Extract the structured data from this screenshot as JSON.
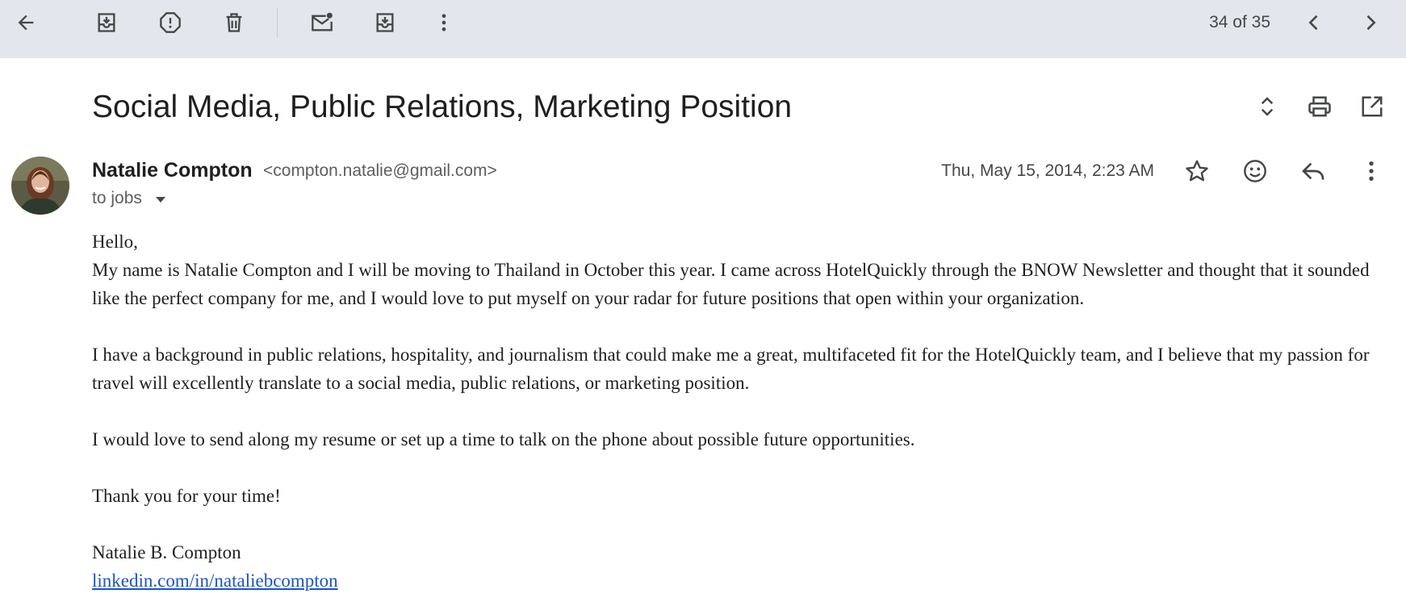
{
  "toolbar": {
    "back_icon": "arrow-left-icon",
    "archive_icon": "archive-icon",
    "spam_icon": "report-spam-icon",
    "delete_icon": "trash-icon",
    "mark_unread_icon": "mark-unread-icon",
    "move_icon": "move-to-inbox-icon",
    "more_icon": "more-vertical-icon",
    "count": "34 of 35",
    "prev_icon": "chevron-left-icon",
    "next_icon": "chevron-right-icon"
  },
  "email": {
    "subject": "Social Media, Public Relations, Marketing Position",
    "sender_name": "Natalie Compton",
    "sender_email": "<compton.natalie@gmail.com>",
    "to": "to jobs",
    "date": "Thu, May 15, 2014, 2:23 AM",
    "body": {
      "greeting": "Hello,",
      "p1": "My name is Natalie Compton and I will be moving to Thailand in October this year. I came across HotelQuickly through the BNOW Newsletter and thought that it sounded like the perfect company for me, and I would love to put myself on your radar for future positions that open within your organization.",
      "p2": "I have a background in public relations, hospitality, and journalism that could make me a great, multifaceted fit for the HotelQuickly team, and I believe that my passion for travel will excellently translate to a social media, public relations, or marketing position.",
      "p3": "I would love to send along my resume or set up a time to talk on the phone about possible future opportunities.",
      "p4": "Thank you for your time!",
      "signature_name": "Natalie B. Compton",
      "signature_link": "linkedin.com/in/nataliebcompton"
    }
  },
  "colors": {
    "toolbar_bg": "#e3e6ec",
    "link": "#1a55c7",
    "icon": "#444746"
  }
}
